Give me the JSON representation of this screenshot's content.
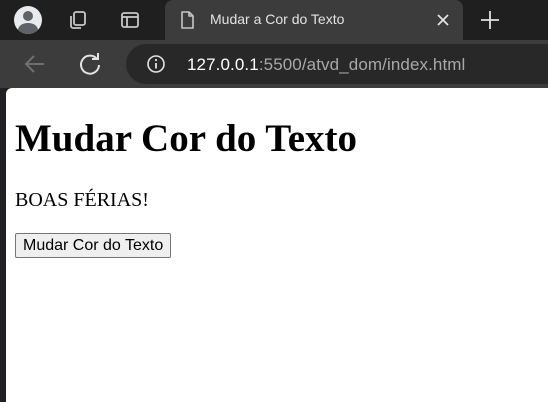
{
  "browser": {
    "tab": {
      "title": "Mudar a Cor do Texto"
    },
    "address": {
      "host": "127.0.0.1",
      "path": ":5500/atvd_dom/index.html"
    },
    "icons": {
      "profile": "avatar-icon",
      "workspaces": "workspaces-icon",
      "tab_actions": "tab-search-icon",
      "favicon": "document-icon",
      "close_tab": "close-icon",
      "new_tab": "plus-icon",
      "back": "back-arrow-icon",
      "reload": "reload-icon",
      "site_info": "info-icon"
    }
  },
  "page": {
    "heading": "Mudar Cor do Texto",
    "text": "BOAS FÉRIAS!",
    "button_label": "Mudar Cor do Texto"
  },
  "colors": {
    "chrome_bg": "#1f1f1f",
    "tab_bg": "#3c3c3c",
    "omnibox_bg": "#282828",
    "page_bg": "#ffffff"
  }
}
